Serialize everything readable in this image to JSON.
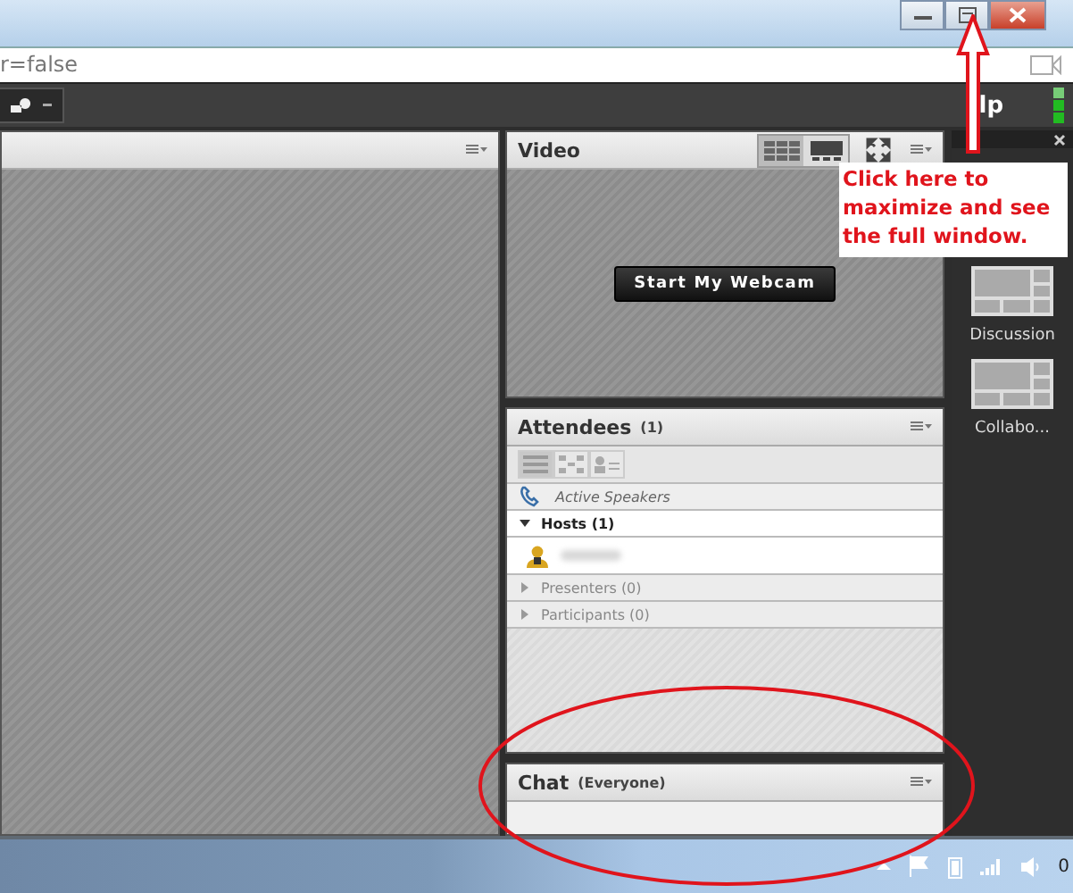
{
  "address_bar": {
    "text": "r=false"
  },
  "toolbar": {
    "menu_label": "lp"
  },
  "video_pod": {
    "title": "Video",
    "button": "Start My Webcam",
    "view_modes": [
      {
        "kind": "grid",
        "selected": true
      },
      {
        "kind": "single",
        "selected": false
      }
    ]
  },
  "attendees_pod": {
    "title": "Attendees",
    "count": "(1)",
    "views": [
      {
        "kind": "list",
        "selected": true
      },
      {
        "kind": "breakout",
        "selected": false
      },
      {
        "kind": "person",
        "selected": false
      }
    ],
    "active_speakers": "Active Speakers",
    "groups": [
      {
        "label": "Hosts (1)",
        "expanded": true
      },
      {
        "label": "Presenters (0)",
        "expanded": false
      },
      {
        "label": "Participants (0)",
        "expanded": false
      }
    ]
  },
  "chat_pod": {
    "title": "Chat",
    "scope": "(Everyone)"
  },
  "layouts": [
    {
      "label": "Discussion"
    },
    {
      "label": "Collabo..."
    }
  ],
  "callout": {
    "text": "Click here to maximize and see the full window."
  },
  "taskbar": {
    "clock": "0"
  }
}
